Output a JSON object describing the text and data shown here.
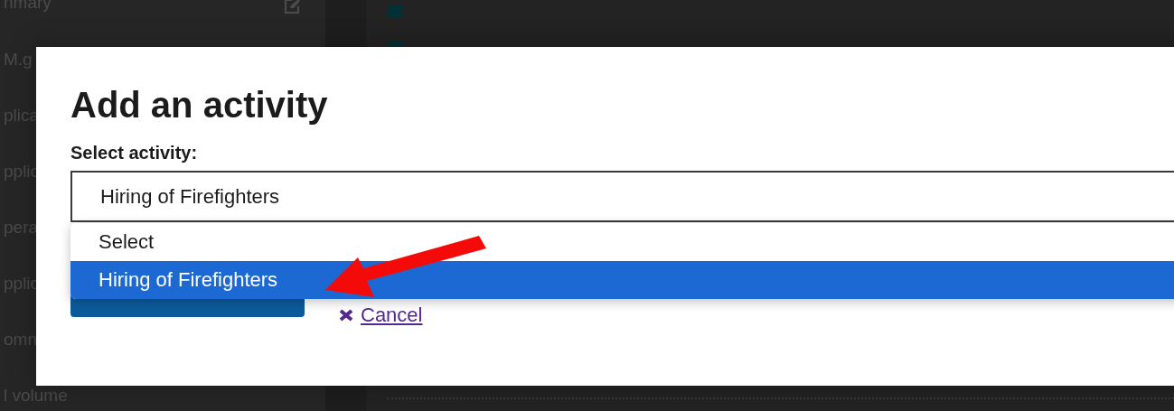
{
  "sidebar": {
    "items": [
      {
        "label": "nmary",
        "kind": "link-edit"
      },
      {
        "label": "M.g",
        "kind": "plain"
      },
      {
        "label": "plica",
        "kind": "plain"
      },
      {
        "label": "pplic",
        "kind": "plain"
      },
      {
        "label": "pera",
        "kind": "plain"
      },
      {
        "label": "pplic",
        "kind": "plain"
      },
      {
        "label": "omn",
        "kind": "plain"
      },
      {
        "label": "l volume",
        "kind": "plain"
      }
    ]
  },
  "dialog": {
    "title": "Add an activity",
    "field_label": "Select activity:",
    "select": {
      "value": "Hiring of Firefighters",
      "expanded": true,
      "options": [
        {
          "label": "Select",
          "selected": false
        },
        {
          "label": "Hiring of Firefighters",
          "selected": true
        }
      ]
    },
    "cancel": {
      "label": "Cancel"
    }
  }
}
